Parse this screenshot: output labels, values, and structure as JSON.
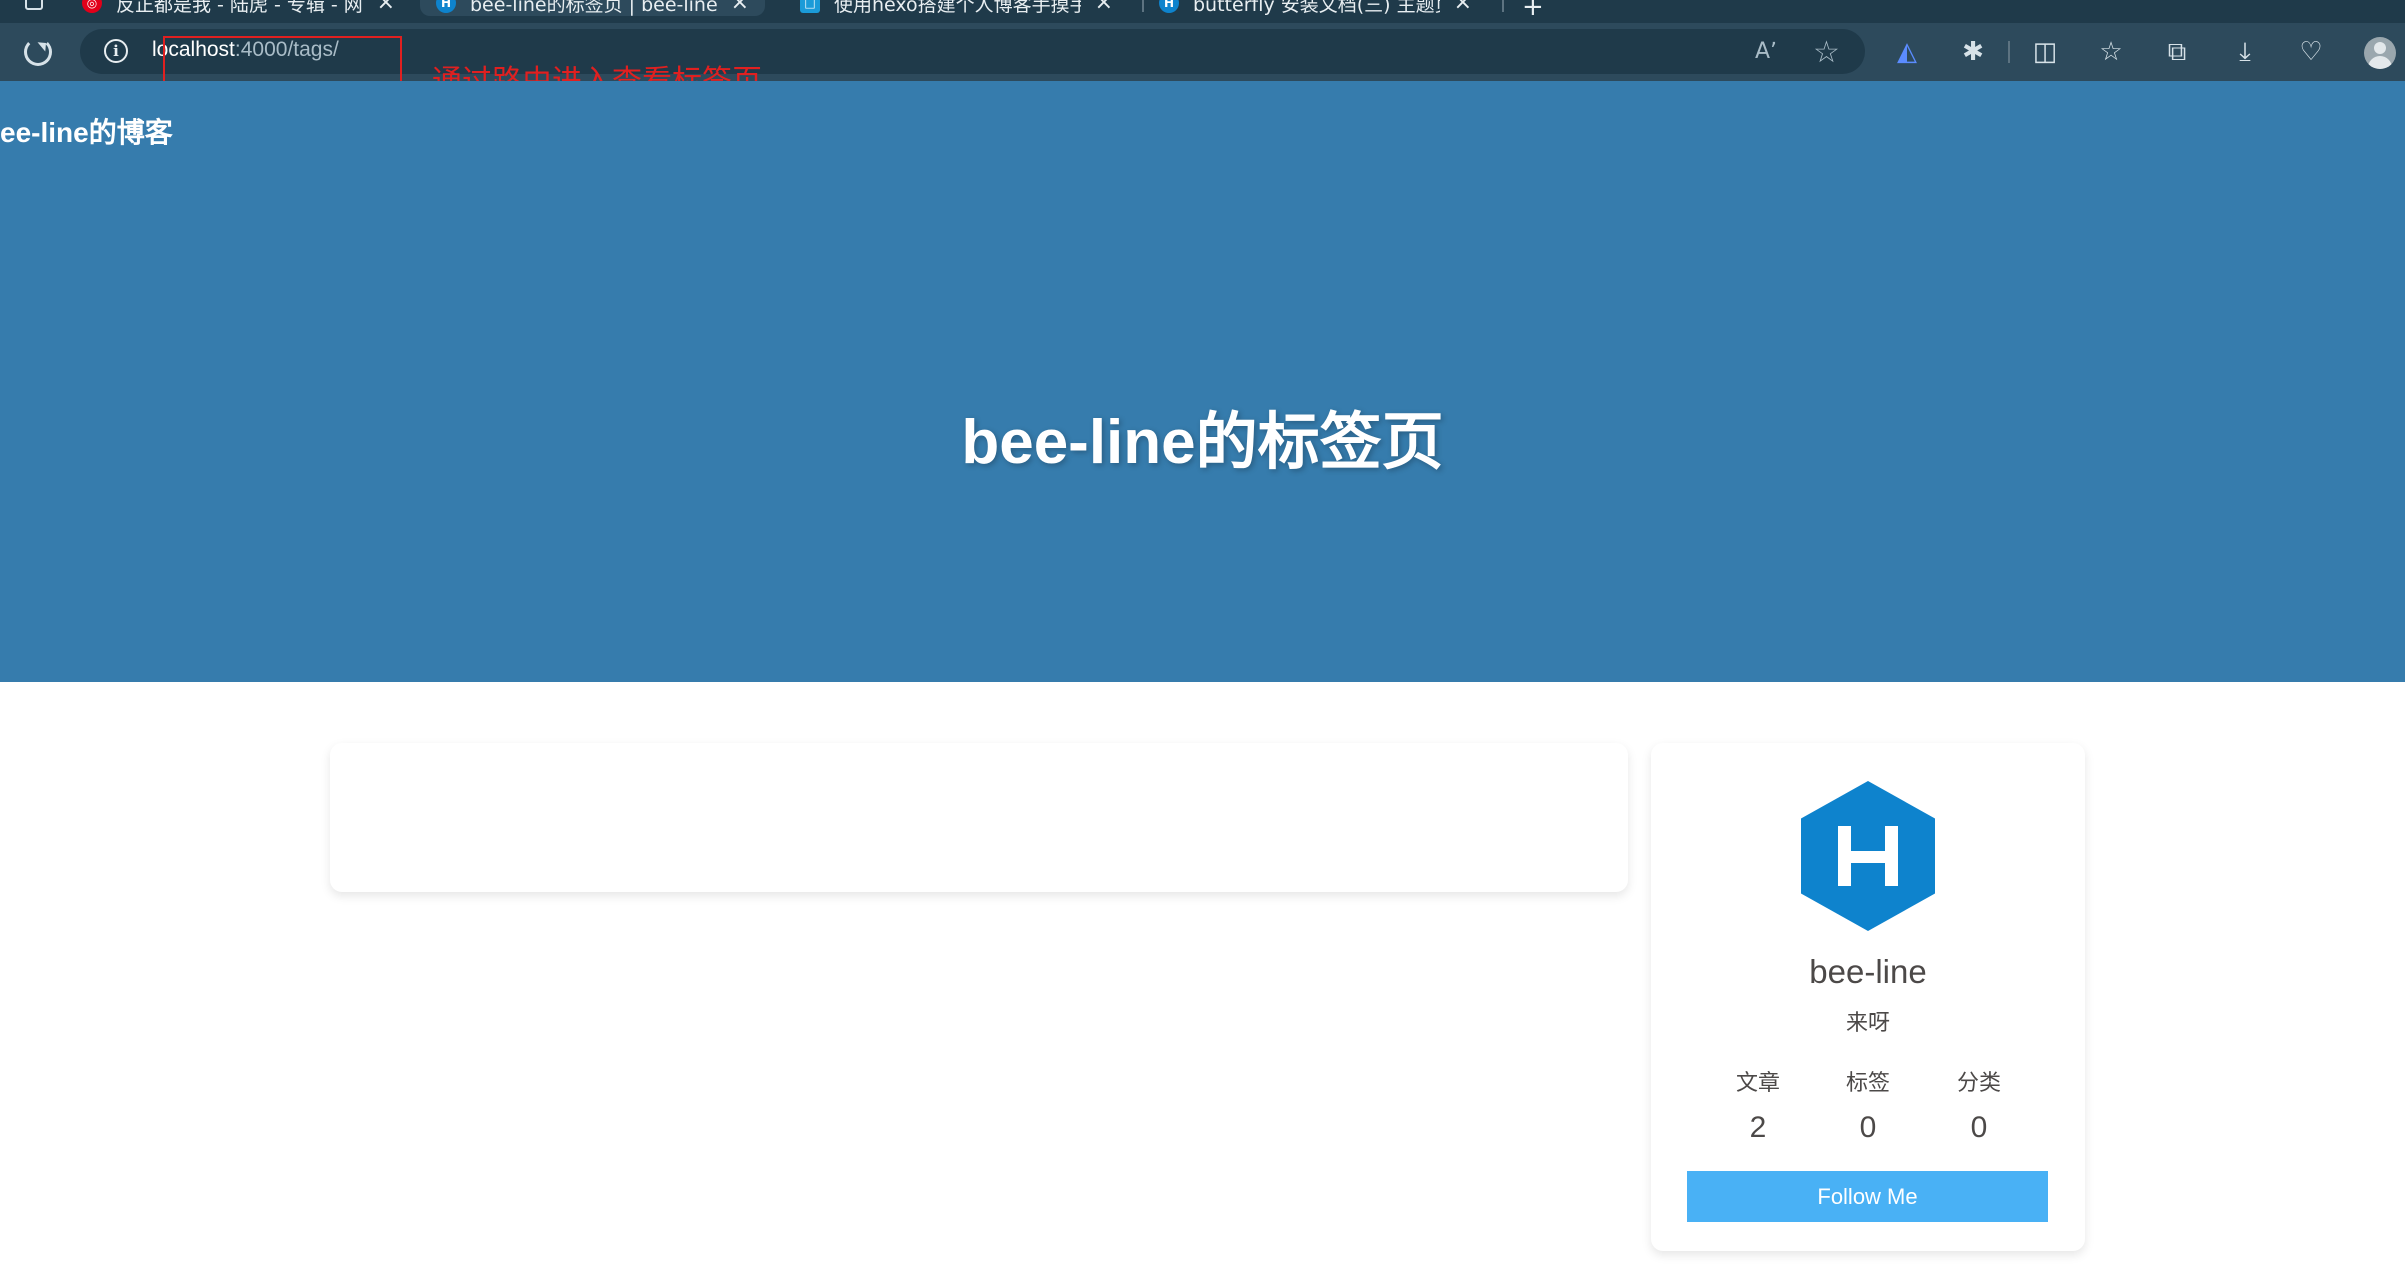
{
  "browser": {
    "tabs": [
      {
        "title": "反正都是我 - 陆虎 - 专辑 - 网易云音乐",
        "favicon_color": "#e2001a",
        "favicon_glyph": "◎",
        "active": false
      },
      {
        "title": "bee-line的标签页 | bee-line的博客",
        "favicon_color": "#0e83cd",
        "favicon_glyph": "H",
        "active": true
      },
      {
        "title": "使用hexo搭建个人博客手摸手教程",
        "favicon_color": "#1b9bd8",
        "favicon_glyph": "□",
        "active": false
      },
      {
        "title": "butterfly 安装文档(三) 主题页面",
        "favicon_color": "#0e83cd",
        "favicon_glyph": "H",
        "active": false
      }
    ],
    "close_glyph": "×",
    "new_tab_glyph": "+",
    "url_host": "localhost",
    "url_path": ":4000/tags/",
    "info_glyph": "i",
    "read_aloud_glyph": "Aʼ",
    "favorite_glyph": "☆",
    "toolbar_icons": [
      {
        "name": "copilot-icon",
        "glyph": "◭"
      },
      {
        "name": "extensions-icon",
        "glyph": "✱"
      },
      {
        "name": "split-screen-icon",
        "glyph": "◫"
      },
      {
        "name": "favorites-icon",
        "glyph": "☆"
      },
      {
        "name": "collections-icon",
        "glyph": "⧉"
      },
      {
        "name": "downloads-icon",
        "glyph": "⤓"
      },
      {
        "name": "browser-essentials-icon",
        "glyph": "♡"
      }
    ]
  },
  "annotation": {
    "text": "通过路由进入查看标签页",
    "color": "#e02020"
  },
  "page": {
    "site_name": "ee-line的博客",
    "title": "bee-line的标签页",
    "hero_color": "#367cad"
  },
  "author": {
    "logo_letter": "H",
    "logo_color": "#0e83cd",
    "name": "bee-line",
    "description": "来呀",
    "stats": [
      {
        "label": "文章",
        "value": "2"
      },
      {
        "label": "标签",
        "value": "0"
      },
      {
        "label": "分类",
        "value": "0"
      }
    ],
    "follow_label": "Follow Me",
    "follow_color": "#49b1f5"
  }
}
